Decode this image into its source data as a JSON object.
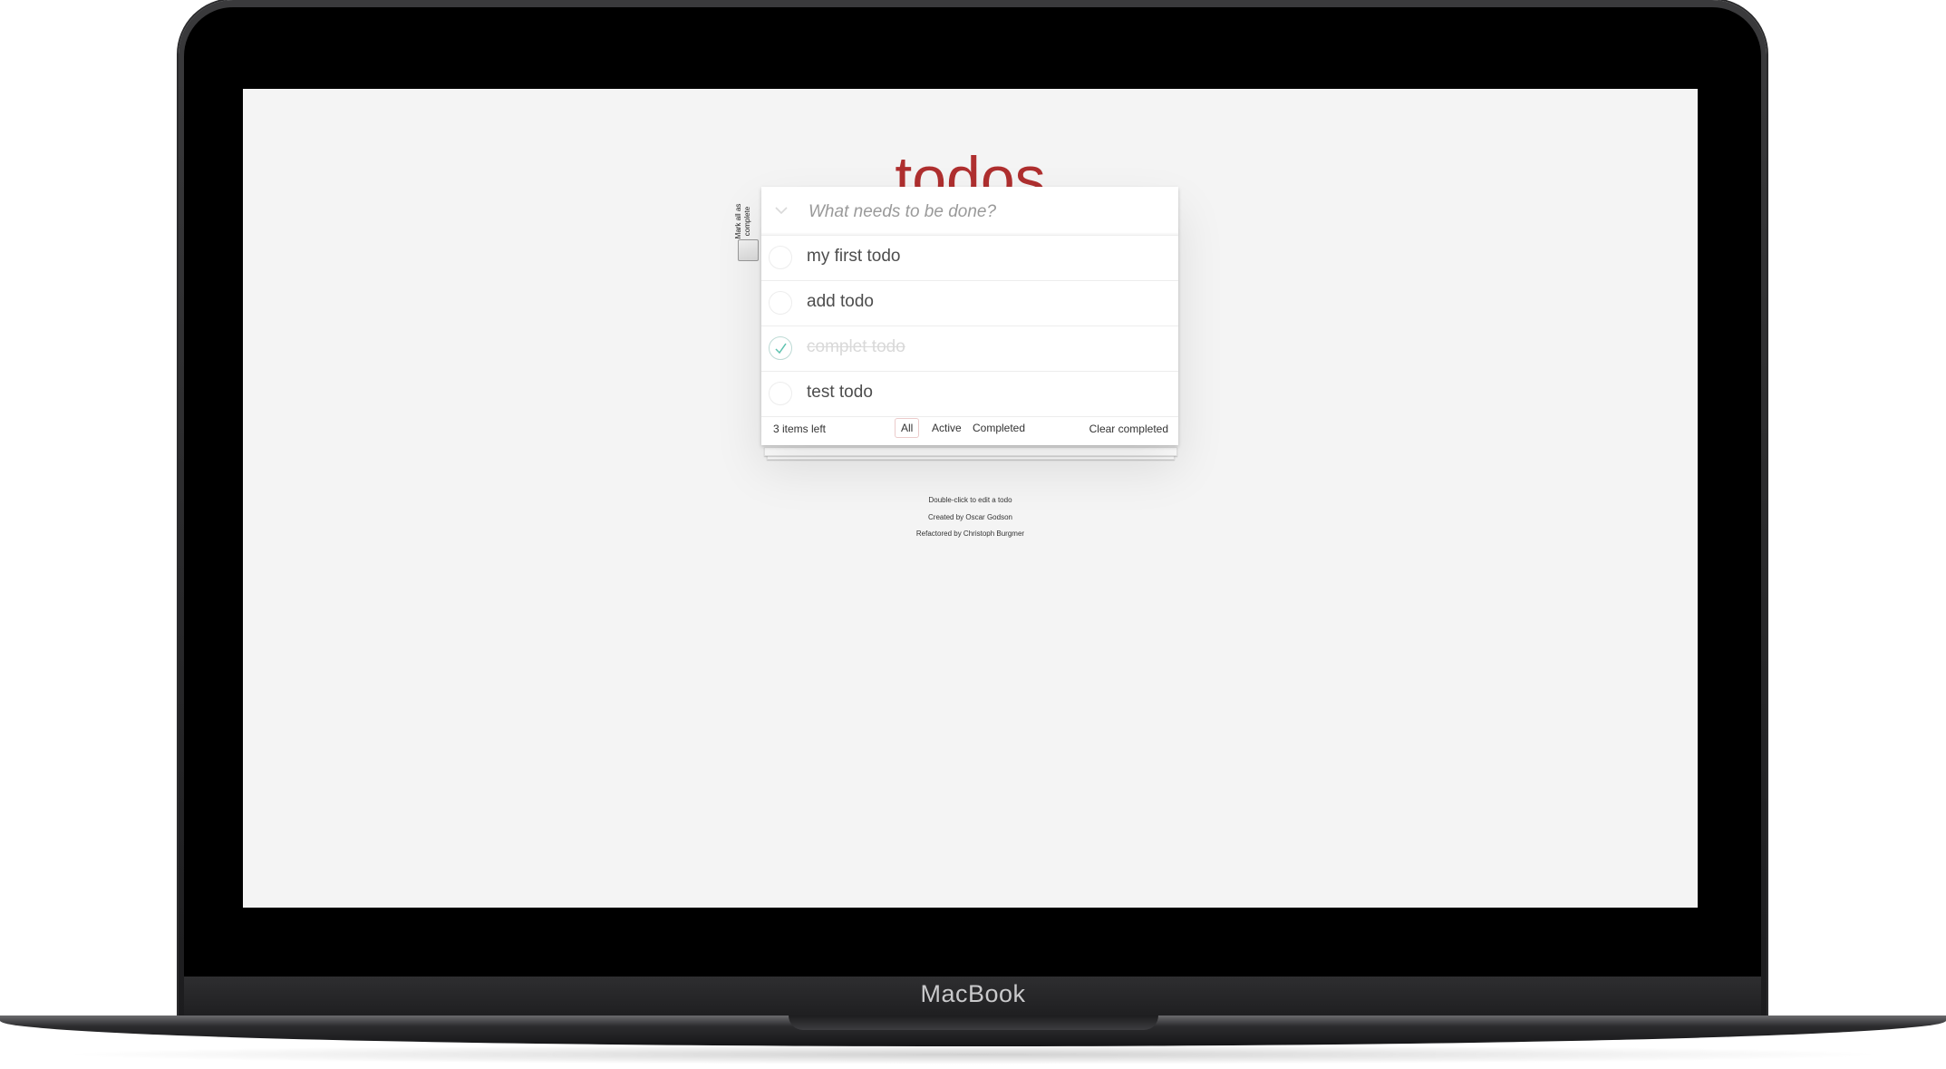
{
  "device": {
    "brand": "MacBook"
  },
  "app": {
    "title": "todos",
    "toggle_all_label": "Mark all as complete",
    "new_todo_placeholder": "What needs to be done?",
    "todos": [
      {
        "text": "my first todo",
        "completed": false
      },
      {
        "text": "add todo",
        "completed": false
      },
      {
        "text": "complet todo",
        "completed": true
      },
      {
        "text": "test todo",
        "completed": false
      }
    ],
    "footer": {
      "count": "3 items left",
      "filters": [
        "All",
        "Active",
        "Completed"
      ],
      "selected_filter": "All",
      "clear_completed": "Clear completed"
    },
    "info": [
      "Double-click to edit a todo",
      "Created by Oscar Godson",
      "Refactored by Christoph Burgmer"
    ]
  },
  "colors": {
    "title": "#af2f2f",
    "background": "#f4f4f4",
    "check": "#5dc2af"
  }
}
